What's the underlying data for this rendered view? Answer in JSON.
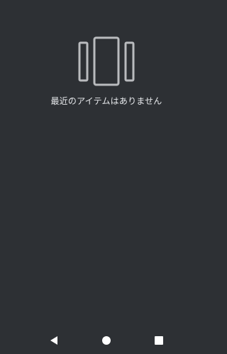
{
  "recents": {
    "empty_message": "最近のアイテムはありません",
    "icon": "recent-apps-empty-icon"
  },
  "navigation": {
    "back_icon": "back-triangle-icon",
    "home_icon": "home-circle-icon",
    "recents_icon": "overview-square-icon"
  },
  "colors": {
    "background": "#2d3034",
    "icon": "#b9bbbe",
    "text": "#e8eaed",
    "nav_icon": "#ffffff"
  }
}
